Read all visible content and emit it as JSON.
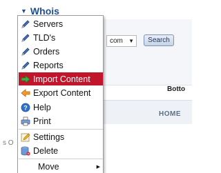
{
  "app": {
    "whois_label": "Whois"
  },
  "search_form": {
    "domain_select_value": "com",
    "search_button_label": "Search"
  },
  "labels": {
    "bottom": "Botto",
    "home": "HOME",
    "left_edge": "s O"
  },
  "context_menu": {
    "items": [
      {
        "label": "Servers",
        "icon": "pencil-icon"
      },
      {
        "label": "TLD's",
        "icon": "pencil-icon"
      },
      {
        "label": "Orders",
        "icon": "pencil-icon"
      },
      {
        "label": "Reports",
        "icon": "pencil-icon"
      },
      {
        "label": "Import Content",
        "icon": "green-arrow-right-icon",
        "highlighted": true
      },
      {
        "label": "Export Content",
        "icon": "orange-arrow-left-icon"
      },
      {
        "label": "Help",
        "icon": "help-icon"
      },
      {
        "label": "Print",
        "icon": "printer-icon"
      },
      {
        "label": "Settings",
        "icon": "settings-icon"
      },
      {
        "label": "Delete",
        "icon": "database-delete-icon"
      },
      {
        "label": "Move",
        "icon": "",
        "has_submenu": true
      }
    ]
  },
  "colors": {
    "highlight": "#c0152b",
    "link_blue": "#1d4f91"
  }
}
